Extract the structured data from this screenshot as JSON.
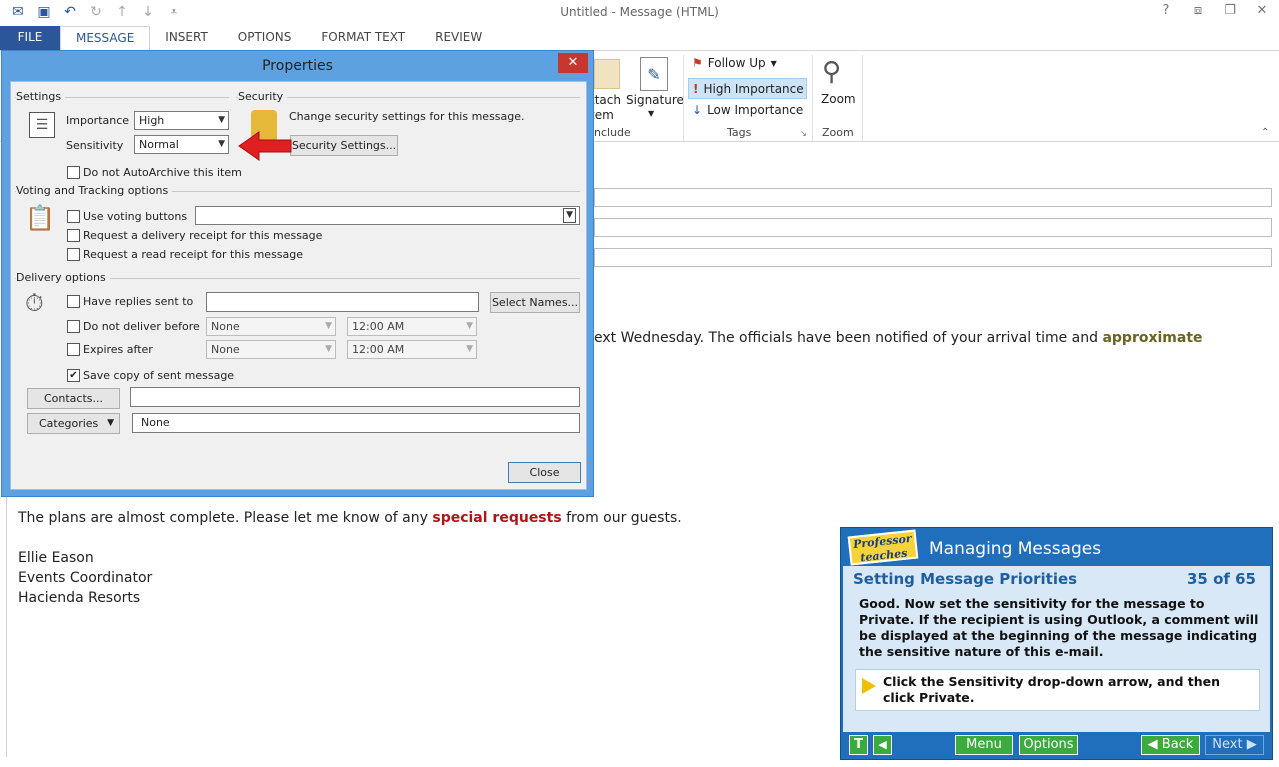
{
  "window": {
    "title": "Untitled - Message (HTML)"
  },
  "qat": {
    "icons": [
      "mail-icon",
      "save-icon",
      "undo-icon",
      "redo-icon",
      "up-icon",
      "down-icon",
      "customize-icon"
    ]
  },
  "window_controls": {
    "help": "?",
    "restore_ribbon": "⧈",
    "maximize": "❐",
    "close": "✕"
  },
  "tabs": [
    "FILE",
    "MESSAGE",
    "INSERT",
    "OPTIONS",
    "FORMAT TEXT",
    "REVIEW"
  ],
  "ribbon": {
    "attach_item": "ttach\ntem",
    "signature": "Signature",
    "include_label": "nclude",
    "follow_up": "Follow Up",
    "high_importance": "High Importance",
    "low_importance": "Low Importance",
    "tags_label": "Tags",
    "zoom": "Zoom",
    "zoom_label": "Zoom"
  },
  "dialog": {
    "title": "Properties",
    "close": "✕",
    "settings_label": "Settings",
    "importance_label": "Importance",
    "importance_value": "High",
    "sensitivity_label": "Sensitivity",
    "sensitivity_value": "Normal",
    "autoarchive": "Do not AutoArchive this item",
    "security_label": "Security",
    "security_text": "Change security settings for this message.",
    "security_button": "Security Settings...",
    "voting_label": "Voting and Tracking options",
    "use_voting": "Use voting buttons",
    "delivery_receipt": "Request a delivery receipt for this message",
    "read_receipt": "Request a read receipt for this message",
    "delivery_label": "Delivery options",
    "have_replies": "Have replies sent to",
    "select_names": "Select Names...",
    "do_not_deliver": "Do not deliver before",
    "expires_after": "Expires after",
    "date_none": "None",
    "time_value": "12:00 AM",
    "save_copy": "Save copy of sent message",
    "save_copy_checked": true,
    "contacts": "Contacts...",
    "categories": "Categories",
    "categories_value": "None",
    "close_button": "Close"
  },
  "message": {
    "line1_pre": "ext Wednesday. The officials have been notified of your arrival time and ",
    "line1_hl": "approximate",
    "line2_pre": "The plans are almost complete. Please let me know of any ",
    "line2_hl": "special requests",
    "line2_post": " from our guests.",
    "sig1": "Ellie Eason",
    "sig2": "Events Coordinator",
    "sig3": "Hacienda Resorts"
  },
  "tutorial": {
    "logo": "Professor teaches",
    "title": "Managing Messages",
    "subtitle": "Setting Message Priorities",
    "count": "35 of 65",
    "text": "Good. Now set the sensitivity for the message to Private. If the recipient is using Outlook, a comment will be displayed at the beginning of the message indicating the sensitive nature of this e-mail.",
    "instruction": "Click the Sensitivity drop-down arrow, and then click Private.",
    "t_button": "T",
    "audio_button": "◀",
    "menu": "Menu",
    "options": "Options",
    "back": "◀ Back",
    "next": "Next ▶"
  },
  "colors": {
    "accent": "#2b579a",
    "arrow": "#e02020",
    "green": "#3bab3d"
  }
}
